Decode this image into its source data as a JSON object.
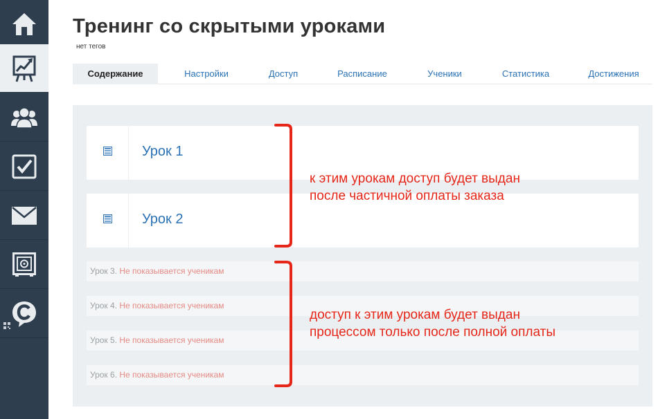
{
  "sidebar": {
    "items": [
      {
        "icon": "home-icon",
        "active": false
      },
      {
        "icon": "training-chart-icon",
        "active": true
      },
      {
        "icon": "users-icon",
        "active": false
      },
      {
        "icon": "tasks-checkbox-icon",
        "active": false
      },
      {
        "icon": "mail-icon",
        "active": false
      },
      {
        "icon": "safe-icon",
        "active": false
      },
      {
        "icon": "chat-c-icon",
        "active": false
      }
    ],
    "qr_icon": "qr-code-icon"
  },
  "header": {
    "title": "Тренинг со скрытыми уроками",
    "tags": "нет тегов"
  },
  "tabs": [
    {
      "label": "Содержание",
      "active": true
    },
    {
      "label": "Настройки",
      "active": false
    },
    {
      "label": "Доступ",
      "active": false
    },
    {
      "label": "Расписание",
      "active": false
    },
    {
      "label": "Ученики",
      "active": false
    },
    {
      "label": "Статистика",
      "active": false
    },
    {
      "label": "Достижения",
      "active": false
    }
  ],
  "lessons": [
    {
      "title": "Урок 1",
      "icon": "lesson-list-icon"
    },
    {
      "title": "Урок 2",
      "icon": "lesson-list-icon"
    }
  ],
  "hidden_lessons": [
    {
      "num": "Урок 3.",
      "note": "Не показывается ученикам"
    },
    {
      "num": "Урок 4.",
      "note": "Не показывается ученикам"
    },
    {
      "num": "Урок 5.",
      "note": "Не показывается ученикам"
    },
    {
      "num": "Урок 6.",
      "note": "Не показывается ученикам"
    }
  ],
  "annotations": {
    "top": [
      "к этим урокам доступ будет выдан",
      "после частичной оплаты заказа"
    ],
    "bottom": [
      "доступ к этим урокам будет выдан",
      "процессом только после полной оплаты"
    ]
  },
  "colors": {
    "sidebar": "#2e3e4e",
    "link": "#2a72b5",
    "annotation": "#e52619",
    "hidden_note": "#e58a84",
    "panel": "#eceff1"
  }
}
